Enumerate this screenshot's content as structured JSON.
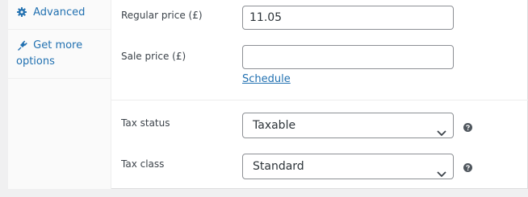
{
  "sidebar": {
    "items": [
      {
        "label": "Advanced",
        "icon": "gear-icon"
      },
      {
        "label": "Get more options",
        "label_line1": "Get more",
        "label_line2": "options",
        "icon": "plugin-icon"
      }
    ]
  },
  "pricing": {
    "regular_price_label": "Regular price (£)",
    "regular_price_value": "11.05",
    "sale_price_label": "Sale price (£)",
    "sale_price_value": "",
    "schedule_link": "Schedule"
  },
  "tax": {
    "status_label": "Tax status",
    "status_value": "Taxable",
    "class_label": "Tax class",
    "class_value": "Standard"
  },
  "colors": {
    "link": "#2271b1",
    "text": "#3c434a",
    "border": "#8c8f94"
  }
}
